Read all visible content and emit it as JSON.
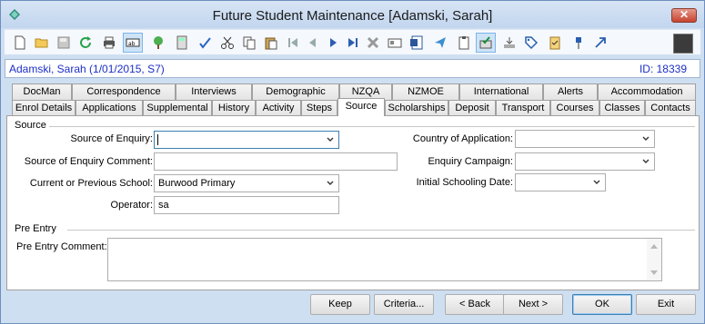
{
  "window": {
    "title": "Future Student Maintenance  [Adamski, Sarah]",
    "close_label": "✕"
  },
  "toolbar": {
    "icons": [
      "new-doc-icon",
      "open-folder-icon",
      "save-icon",
      "refresh-icon",
      "print-icon",
      "field-icon",
      "tree-icon",
      "calculator-icon",
      "spellcheck-icon",
      "cut-icon",
      "copy-icon",
      "paste-icon",
      "first-record-icon",
      "prev-record-icon",
      "next-record-icon",
      "last-record-icon",
      "delete-icon",
      "card-icon",
      "word-icon",
      "send-icon",
      "clipboard-icon",
      "approve-icon",
      "import-icon",
      "tag-icon",
      "checklist-icon",
      "pin-icon",
      "arrow-icon",
      "sidebar-toggle-icon"
    ]
  },
  "student": {
    "name": "Adamski, Sarah (1/01/2015, S7)",
    "id": "ID: 18339"
  },
  "tabs_row1": [
    "DocMan",
    "Correspondence",
    "Interviews",
    "Demographic",
    "NZQA",
    "NZMOE",
    "International",
    "Alerts",
    "Accommodation"
  ],
  "tabs_row2": [
    "Enrol Details",
    "Applications",
    "Supplemental",
    "History",
    "Activity",
    "Steps",
    "Source",
    "Scholarships",
    "Deposit",
    "Transport",
    "Courses",
    "Classes",
    "Contacts"
  ],
  "active_tab": "Source",
  "source": {
    "group_title": "Source",
    "source_of_enquiry_label": "Source of Enquiry:",
    "source_of_enquiry_value": "",
    "source_comment_label": "Source of Enquiry Comment:",
    "source_comment_value": "",
    "previous_school_label": "Current or Previous School:",
    "previous_school_value": "Burwood Primary",
    "operator_label": "Operator:",
    "operator_value": "sa",
    "country_label": "Country of Application:",
    "country_value": "",
    "campaign_label": "Enquiry Campaign:",
    "campaign_value": "",
    "schooling_date_label": "Initial Schooling Date:",
    "schooling_date_value": ""
  },
  "pre_entry": {
    "group_title": "Pre Entry",
    "comment_label": "Pre Entry Comment:",
    "comment_value": ""
  },
  "buttons": {
    "keep": "Keep",
    "criteria": "Criteria...",
    "back": "< Back",
    "next": "Next >",
    "ok": "OK",
    "exit": "Exit"
  }
}
